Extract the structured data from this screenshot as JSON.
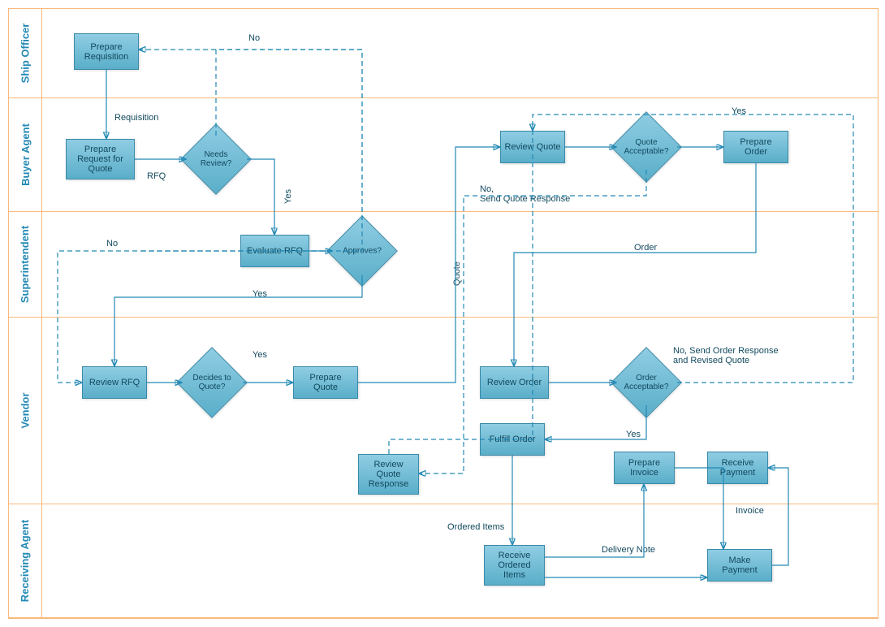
{
  "lanes": {
    "ship_officer": "Ship Officer",
    "buyer_agent": "Buyer Agent",
    "superintendent": "Superintendent",
    "vendor": "Vendor",
    "receiving_agent": "Receiving Agent"
  },
  "boxes": {
    "prepare_requisition": "Prepare Requisition",
    "prepare_rfq": "Prepare Request for Quote",
    "evaluate_rfq": "Evaluate RFQ",
    "review_rfq": "Review RFQ",
    "prepare_quote": "Prepare Quote",
    "review_quote": "Review Quote",
    "prepare_order": "Prepare Order",
    "review_quote_response": "Review Quote Response",
    "review_order": "Review Order",
    "fulfill_order": "Fulfill Order",
    "prepare_invoice": "Prepare Invoice",
    "receive_payment": "Receive Payment",
    "receive_ordered_items": "Receive Ordered Items",
    "make_payment": "Make Payment"
  },
  "decisions": {
    "needs_review": "Needs Review?",
    "approves": "Approves?",
    "decides_to_quote": "Decides to Quote?",
    "quote_acceptable": "Quote Acceptable?",
    "order_acceptable": "Order Acceptable?"
  },
  "edges": {
    "no1": "No",
    "requisition": "Requisition",
    "rfq": "RFQ",
    "yes1": "Yes",
    "no2": "No",
    "yes2": "Yes",
    "yes3": "Yes",
    "quote": "Quote",
    "yes4": "Yes",
    "no_send_quote": "No,\nSend Quote Response",
    "order": "Order",
    "no_send_order": "No, Send Order Response and Revised Quote",
    "yes5": "Yes",
    "ordered_items": "Ordered Items",
    "delivery_note": "Delivery Note",
    "invoice": "Invoice"
  }
}
